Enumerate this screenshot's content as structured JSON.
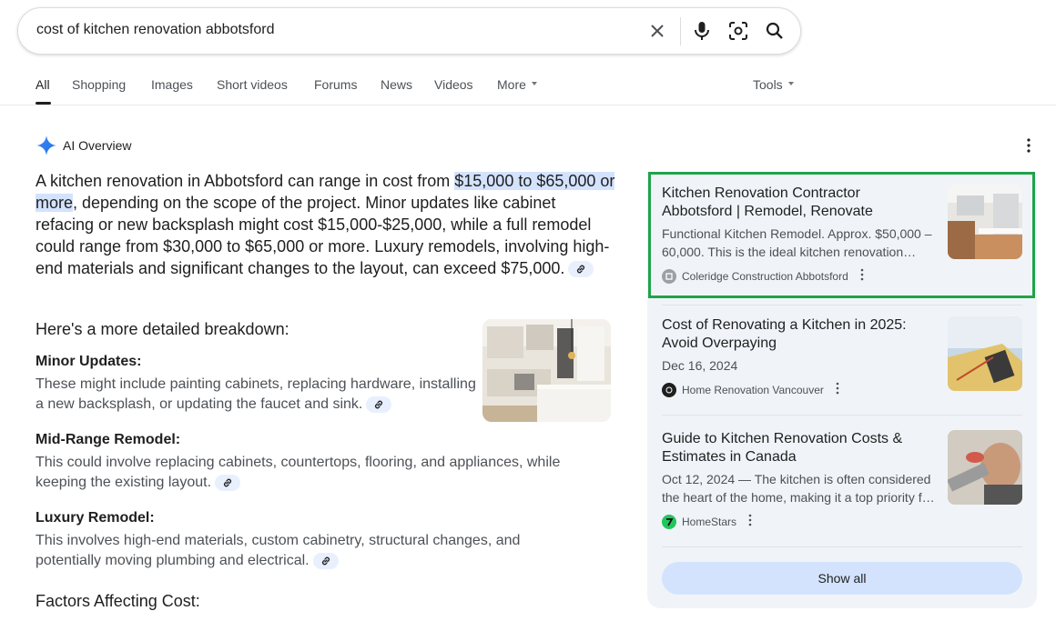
{
  "search": {
    "query": "cost of kitchen renovation abbotsford",
    "icons": [
      "clear-icon",
      "mic-icon",
      "lens-icon",
      "search-icon"
    ]
  },
  "tabs": {
    "items": [
      {
        "label": "All",
        "active": true
      },
      {
        "label": "Shopping"
      },
      {
        "label": "Images"
      },
      {
        "label": "Short videos"
      },
      {
        "label": "Forums"
      },
      {
        "label": "News"
      },
      {
        "label": "Videos"
      },
      {
        "label": "More"
      }
    ],
    "tools": "Tools"
  },
  "ai_overview": {
    "label": "AI Overview",
    "intro_pre": "A kitchen renovation in Abbotsford can range in cost from ",
    "intro_highlight": "$15,000 to $65,000 or more",
    "intro_post": ", depending on the scope of the project. Minor updates like cabinet refacing or new backsplash might cost $15,000-$25,000, while a full remodel could range from $30,000 to $65,000 or more. Luxury remodels, involving high-end materials and significant changes to the layout, can exceed $75,000.",
    "breakdown_heading": "Here's a more detailed breakdown:",
    "sections": [
      {
        "heading": "Minor Updates:",
        "text": "These might include painting cabinets, replacing hardware, installing a new backsplash, or updating the faucet and sink."
      },
      {
        "heading": "Mid-Range Remodel:",
        "text": "This could involve replacing cabinets, countertops, flooring, and appliances, while keeping the existing layout."
      },
      {
        "heading": "Luxury Remodel:",
        "text": "This involves high-end materials, custom cabinetry, structural changes, and potentially moving plumbing and electrical."
      }
    ],
    "factors_heading": "Factors Affecting Cost:"
  },
  "sources": {
    "cards": [
      {
        "title": "Kitchen Renovation Contractor Abbotsford | Remodel, Renovate",
        "desc": "Functional Kitchen Remodel. Approx. $50,000 – 60,000. This is the ideal kitchen renovation…",
        "site": "Coleridge Construction Abbotsford"
      },
      {
        "title": "Cost of Renovating a Kitchen in 2025: Avoid Overpaying",
        "desc": "Dec 16, 2024",
        "site": "Home Renovation Vancouver"
      },
      {
        "title": "Guide to Kitchen Renovation Costs & Estimates in Canada",
        "desc": "Oct 12, 2024 — The kitchen is often considered the heart of the home, making it a top priority f…",
        "site": "HomeStars"
      }
    ],
    "show_all": "Show all"
  },
  "colors": {
    "highlight": "#d3e3fd",
    "panel_bg": "#f0f4f9",
    "selection_box": "#1fa34a"
  }
}
